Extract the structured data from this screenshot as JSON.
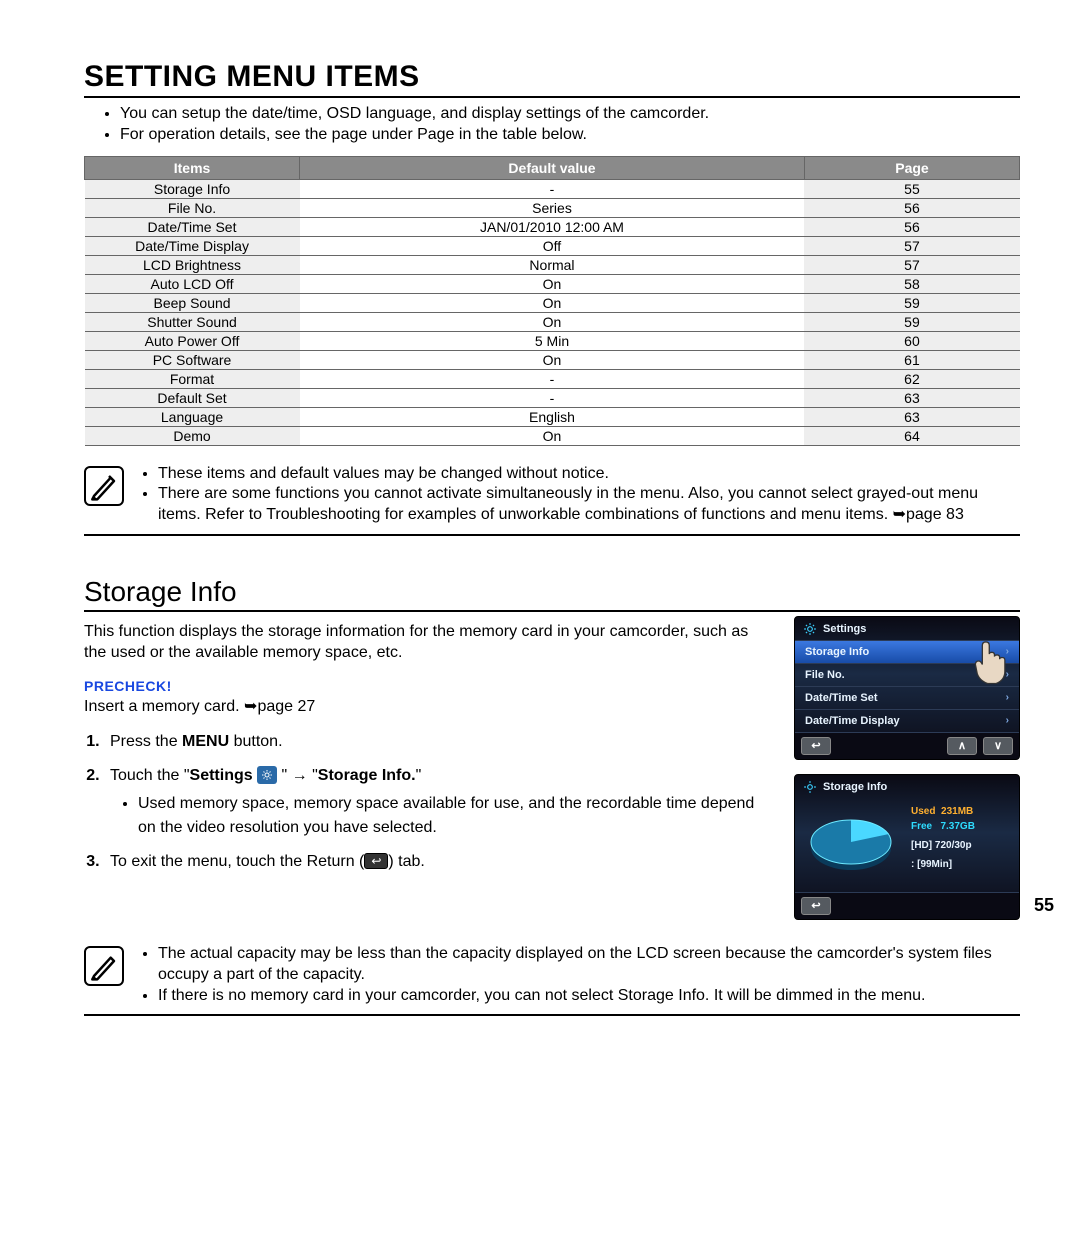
{
  "page_number": "55",
  "section_title": "SETTING MENU ITEMS",
  "intro_bullets": [
    "You can setup the date/time, OSD language, and display settings of the camcorder.",
    "For operation details, see the page under Page in the table below."
  ],
  "table": {
    "headers": {
      "items": "Items",
      "default": "Default value",
      "page": "Page"
    },
    "rows": [
      {
        "item": "Storage Info",
        "default": "-",
        "page": "55"
      },
      {
        "item": "File No.",
        "default": "Series",
        "page": "56"
      },
      {
        "item": "Date/Time Set",
        "default": "JAN/01/2010 12:00 AM",
        "page": "56"
      },
      {
        "item": "Date/Time Display",
        "default": "Off",
        "page": "57"
      },
      {
        "item": "LCD Brightness",
        "default": "Normal",
        "page": "57"
      },
      {
        "item": "Auto LCD Off",
        "default": "On",
        "page": "58"
      },
      {
        "item": "Beep Sound",
        "default": "On",
        "page": "59"
      },
      {
        "item": "Shutter Sound",
        "default": "On",
        "page": "59"
      },
      {
        "item": "Auto Power Off",
        "default": "5 Min",
        "page": "60"
      },
      {
        "item": "PC Software",
        "default": "On",
        "page": "61"
      },
      {
        "item": "Format",
        "default": "-",
        "page": "62"
      },
      {
        "item": "Default Set",
        "default": "-",
        "page": "63"
      },
      {
        "item": "Language",
        "default": "English",
        "page": "63"
      },
      {
        "item": "Demo",
        "default": "On",
        "page": "64"
      }
    ]
  },
  "note1": [
    "These items and default values may be changed without notice.",
    "There are some functions you cannot activate simultaneously in the menu. Also, you cannot select grayed-out menu items. Refer to Troubleshooting for examples of unworkable combinations of functions and menu items. ➥page 83"
  ],
  "subsection_title": "Storage Info",
  "storage_text": "This function displays the storage information for the memory card in your camcorder, such as the used or the available memory space, etc.",
  "precheck_label": "PRECHECK!",
  "precheck_text": "Insert a memory card. ➥page 27",
  "steps": {
    "s1_a": "Press the ",
    "s1_b": "MENU",
    "s1_c": " button.",
    "s2_a": "Touch the \"",
    "s2_b": "Settings",
    "s2_c": " \" → \"",
    "s2_d": "Storage Info.",
    "s2_e": "\"",
    "s2_sub": "Used memory space, memory space available for use, and the recordable time depend on the video resolution you have selected.",
    "s3_a": "To exit the menu, touch the Return (",
    "s3_b": ") tab."
  },
  "note2": [
    "The actual capacity may be less than the capacity displayed on the LCD screen because the camcorder's system files occupy a part of the capacity.",
    "If there is no memory card in your camcorder, you can not select Storage Info. It will be dimmed in the menu."
  ],
  "lcd1": {
    "title": "Settings",
    "items": [
      "Storage Info",
      "File No.",
      "Date/Time Set",
      "Date/Time Display"
    ]
  },
  "lcd2": {
    "title": "Storage Info",
    "used_label": "Used",
    "used_value": "231MB",
    "free_label": "Free",
    "free_value": "7.37GB",
    "hd_label": "[HD] 720/30p",
    "hd_value": ": [99Min]"
  }
}
